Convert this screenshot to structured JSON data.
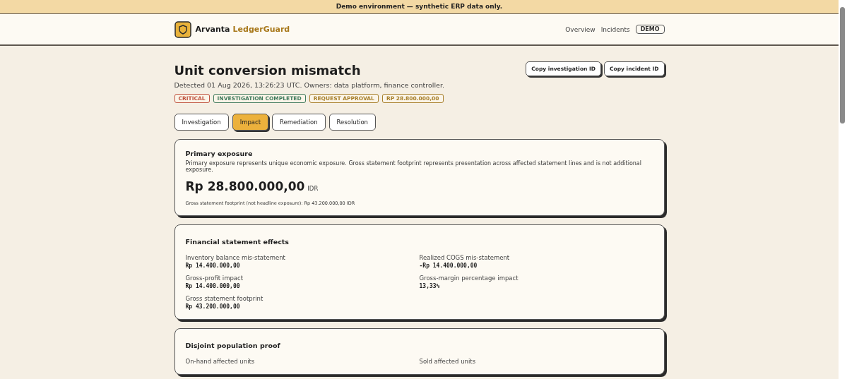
{
  "banner": "Demo environment — synthetic ERP data only.",
  "header": {
    "brand_first": "Arvanta",
    "brand_second": "LedgerGuard",
    "nav": [
      "Overview",
      "Incidents"
    ],
    "env_badge": "DEMO"
  },
  "incident": {
    "title": "Unit conversion mismatch",
    "meta": "Detected 01 Aug 2026, 13:26:23 UTC. Owners: data platform, finance controller.",
    "actions": [
      "Copy investigation ID",
      "Copy incident ID"
    ],
    "badges": [
      {
        "label": "CRITICAL",
        "color": "#c0533f"
      },
      {
        "label": "INVESTIGATION COMPLETED",
        "color": "#3f7a5c"
      },
      {
        "label": "REQUEST APPROVAL",
        "color": "#a8802c"
      },
      {
        "label": "RP 28.800.000,00",
        "color": "#a8802c"
      }
    ]
  },
  "tabs": [
    {
      "label": "Investigation",
      "selected": false
    },
    {
      "label": "Impact",
      "selected": true
    },
    {
      "label": "Remediation",
      "selected": false
    },
    {
      "label": "Resolution",
      "selected": false
    }
  ],
  "primary_exposure": {
    "title": "Primary exposure",
    "description": "Primary exposure represents unique economic exposure. Gross statement footprint represents presentation across affected statement lines and is not additional exposure.",
    "amount": "Rp 28.800.000,00",
    "currency": "IDR",
    "footnote": "Gross statement footprint (not headline exposure): Rp 43.200.000,00 IDR"
  },
  "sections": [
    {
      "title": "Financial statement effects",
      "fields": [
        {
          "label": "Inventory balance mis-statement",
          "value": "Rp 14.400.000,00"
        },
        {
          "label": "Realized COGS mis-statement",
          "value": "-Rp 14.400.000,00"
        },
        {
          "label": "Gross-profit impact",
          "value": "Rp 14.400.000,00"
        },
        {
          "label": "Gross-margin percentage impact",
          "value": "13,33%"
        },
        {
          "label": "Gross statement footprint",
          "value": "Rp 43.200.000,00"
        }
      ]
    },
    {
      "title": "Disjoint population proof",
      "fields": [
        {
          "label": "On-hand affected units"
        },
        {
          "label": "Sold affected units"
        }
      ]
    }
  ]
}
